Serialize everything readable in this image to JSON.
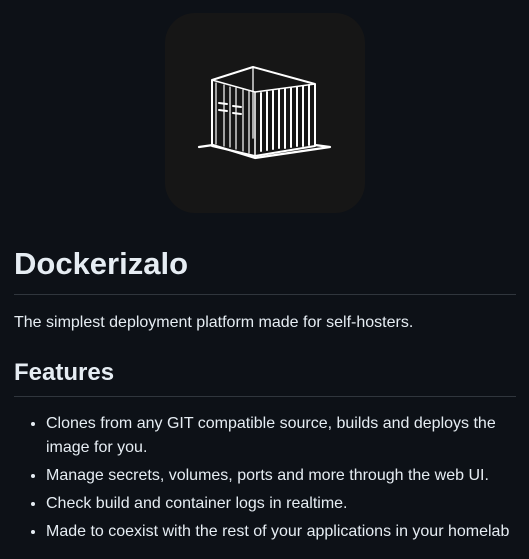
{
  "logo": {
    "icon": "shipping-container-icon",
    "background": "#161616"
  },
  "readme": {
    "title": "Dockerizalo",
    "tagline": "The simplest deployment platform made for self-hosters.",
    "features_heading": "Features",
    "features": [
      "Clones from any GIT compatible source, builds and deploys the image for you.",
      "Manage secrets, volumes, ports and more through the web UI.",
      "Check build and container logs in realtime.",
      "Made to coexist with the rest of your applications in your homelab"
    ]
  },
  "colors": {
    "background": "#0d1117",
    "text": "#e6edf3",
    "divider": "#30363d"
  }
}
